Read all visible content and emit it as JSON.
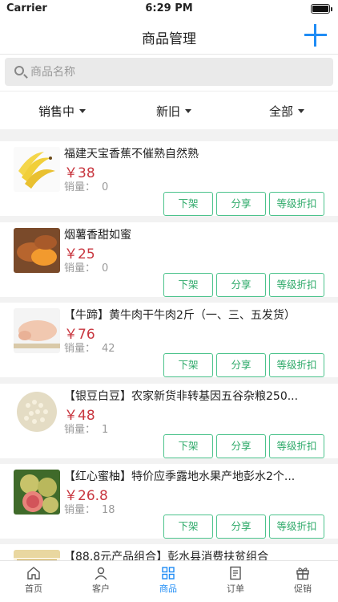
{
  "status_bar": {
    "carrier": "Carrier",
    "time": "6:29 PM"
  },
  "nav": {
    "title": "商品管理"
  },
  "search": {
    "placeholder": "商品名称"
  },
  "filters": [
    {
      "label": "销售中"
    },
    {
      "label": "新旧"
    },
    {
      "label": "全部"
    }
  ],
  "products": [
    {
      "title": "福建天宝香蕉不催熟自然熟",
      "price": "￥38",
      "sales_label": "销量：",
      "sales": "0"
    },
    {
      "title": "烟薯香甜如蜜",
      "price": "￥25",
      "sales_label": "销量：",
      "sales": "0"
    },
    {
      "title": "【牛蹄】黄牛肉干牛肉2斤（一、三、五发货）",
      "price": "￥76",
      "sales_label": "销量：",
      "sales": "42"
    },
    {
      "title": "【银豆白豆】农家新货非转基因五谷杂粮250...",
      "price": "￥48",
      "sales_label": "销量：",
      "sales": "1"
    },
    {
      "title": "【红心蜜柚】特价应季露地水果产地彭水2个...",
      "price": "￥26.8",
      "sales_label": "销量：",
      "sales": "18"
    },
    {
      "title": "【88.8元产品组合】彭水县消费扶贫组合"
    }
  ],
  "actions": {
    "delist": "下架",
    "share": "分享",
    "discount": "等级折扣"
  },
  "tabs": [
    {
      "label": "首页",
      "icon": "home-icon"
    },
    {
      "label": "客户",
      "icon": "user-icon"
    },
    {
      "label": "商品",
      "icon": "grid-icon",
      "active": true
    },
    {
      "label": "订单",
      "icon": "document-icon"
    },
    {
      "label": "促销",
      "icon": "gift-icon"
    }
  ],
  "colors": {
    "accent": "#1f8cf5",
    "price": "#c8363f",
    "button_border": "#4cc38c"
  }
}
